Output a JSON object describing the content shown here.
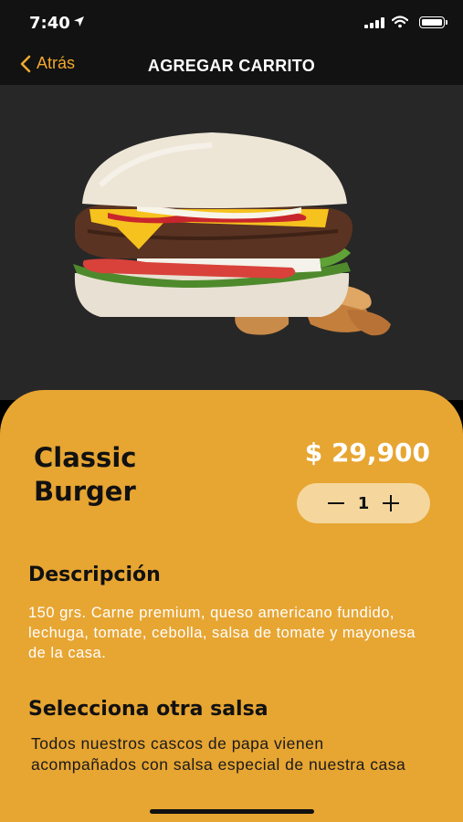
{
  "status_bar": {
    "time": "7:40"
  },
  "nav": {
    "back_label": "Atrás",
    "title": "AGREGAR CARRITO"
  },
  "product": {
    "name": "Classic Burger",
    "price": "$ 29,900",
    "quantity": "1",
    "image": "burger-with-potato-wedges"
  },
  "description": {
    "heading": "Descripción",
    "text": "150 grs. Carne premium, queso americano fundido, lechuga, tomate, cebolla, salsa de tomate y mayonesa de la casa."
  },
  "sauce": {
    "heading": "Selecciona otra salsa",
    "text": "Todos nuestros cascos de papa vienen acompañados con salsa especial de nuestra casa"
  },
  "colors": {
    "accent": "#F0A830",
    "sheet": "#E7A532",
    "hero_bg": "#272727",
    "nav_bg": "#121212"
  }
}
